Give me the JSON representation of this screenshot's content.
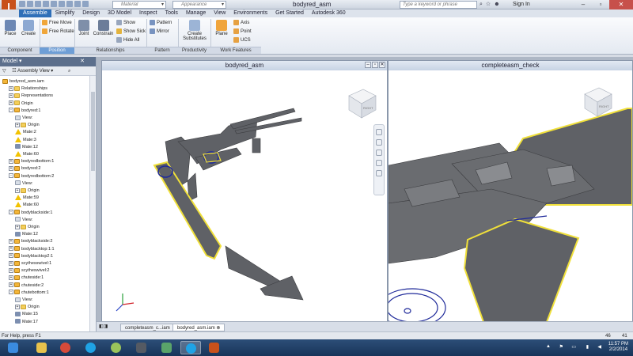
{
  "app": {
    "logo_letter": "I",
    "logo_sub": "PRO",
    "title": "bodyred_asm",
    "material": "Material",
    "appearance": "Appearance",
    "search_placeholder": "Type a keyword or phrase",
    "sign_in": "Sign In"
  },
  "ribbon_tabs": [
    "Assemble",
    "Simplify",
    "Design",
    "3D Model",
    "Inspect",
    "Tools",
    "Manage",
    "View",
    "Environments",
    "Get Started",
    "Autodesk 360"
  ],
  "ribbon": {
    "place": "Place",
    "create": "Create",
    "free_move": "Free Move",
    "free_rotate": "Free Rotate",
    "joint": "Joint",
    "constrain": "Constrain",
    "show": "Show",
    "show_sick": "Show Sick",
    "hide_all": "Hide All",
    "pattern": "Pattern",
    "mirror": "Mirror",
    "create_substitutes_1": "Create",
    "create_substitutes_2": "Substitutes",
    "plane": "Plane",
    "axis": "Axis",
    "point": "Point",
    "ucs": "UCS",
    "panels": {
      "component": "Component",
      "position": "Position",
      "relationships": "Relationships",
      "pattern": "Pattern",
      "productivity": "Productivity",
      "work_features": "Work Features"
    }
  },
  "browser": {
    "title": "Model",
    "view": "Assembly View",
    "nodes": [
      {
        "label": "bodyred_asm.iam",
        "indent": 0,
        "icon": "part",
        "exp": ""
      },
      {
        "label": "Relationships",
        "indent": 1,
        "icon": "folder",
        "exp": "+"
      },
      {
        "label": "Representations",
        "indent": 1,
        "icon": "folder",
        "exp": "+"
      },
      {
        "label": "Origin",
        "indent": 1,
        "icon": "folder",
        "exp": "+"
      },
      {
        "label": "bodyred:1",
        "indent": 1,
        "icon": "part",
        "exp": "-"
      },
      {
        "label": "View:",
        "indent": 2,
        "icon": "view",
        "exp": ""
      },
      {
        "label": "Origin",
        "indent": 2,
        "icon": "folder",
        "exp": "+"
      },
      {
        "label": "Mate:2",
        "indent": 2,
        "icon": "warn",
        "exp": ""
      },
      {
        "label": "Mate:3",
        "indent": 2,
        "icon": "warn",
        "exp": ""
      },
      {
        "label": "Mate:12",
        "indent": 2,
        "icon": "constraint",
        "exp": ""
      },
      {
        "label": "Mate:60",
        "indent": 2,
        "icon": "warn",
        "exp": ""
      },
      {
        "label": "bodyredbottom:1",
        "indent": 1,
        "icon": "part",
        "exp": "+"
      },
      {
        "label": "bodyred:2",
        "indent": 1,
        "icon": "part",
        "exp": "+"
      },
      {
        "label": "bodyredbottom:2",
        "indent": 1,
        "icon": "part",
        "exp": "-"
      },
      {
        "label": "View:",
        "indent": 2,
        "icon": "view",
        "exp": ""
      },
      {
        "label": "Origin",
        "indent": 2,
        "icon": "folder",
        "exp": "+"
      },
      {
        "label": "Mate:59",
        "indent": 2,
        "icon": "warn",
        "exp": ""
      },
      {
        "label": "Mate:60",
        "indent": 2,
        "icon": "warn",
        "exp": ""
      },
      {
        "label": "bodyblackside:1",
        "indent": 1,
        "icon": "part",
        "exp": "-"
      },
      {
        "label": "View:",
        "indent": 2,
        "icon": "view",
        "exp": ""
      },
      {
        "label": "Origin",
        "indent": 2,
        "icon": "folder",
        "exp": "+"
      },
      {
        "label": "Mate:12",
        "indent": 2,
        "icon": "constraint",
        "exp": ""
      },
      {
        "label": "bodyblackside:2",
        "indent": 1,
        "icon": "part",
        "exp": "+"
      },
      {
        "label": "bodyblacktop:1:1",
        "indent": 1,
        "icon": "part",
        "exp": "+"
      },
      {
        "label": "bodyblacktop2:1",
        "indent": 1,
        "icon": "part",
        "exp": "+"
      },
      {
        "label": "scythesswivel:1",
        "indent": 1,
        "icon": "part",
        "exp": "+"
      },
      {
        "label": "scytheswivel:2",
        "indent": 1,
        "icon": "part",
        "exp": "+"
      },
      {
        "label": "chuteside:1",
        "indent": 1,
        "icon": "part",
        "exp": "+"
      },
      {
        "label": "chuteside:2",
        "indent": 1,
        "icon": "part",
        "exp": "+"
      },
      {
        "label": "chutebottom:1",
        "indent": 1,
        "icon": "part",
        "exp": "-"
      },
      {
        "label": "View:",
        "indent": 2,
        "icon": "view",
        "exp": ""
      },
      {
        "label": "Origin",
        "indent": 2,
        "icon": "folder",
        "exp": "+"
      },
      {
        "label": "Mate:15",
        "indent": 2,
        "icon": "constraint",
        "exp": ""
      },
      {
        "label": "Mate:17",
        "indent": 2,
        "icon": "constraint",
        "exp": ""
      }
    ]
  },
  "viewports": {
    "left_title": "bodyred_asm",
    "right_title": "completeasm_check",
    "cube_face": "RIGHT"
  },
  "doc_tabs": [
    "completeasm_c...iam",
    "bodyred_asm.iam"
  ],
  "status": {
    "help": "For Help, press F1",
    "num1": "46",
    "num2": "41"
  },
  "clock": {
    "time": "11:57 PM",
    "date": "2/2/2014"
  },
  "colors": {
    "accent": "#2f6fb8",
    "part_fill": "#5f6166",
    "highlight": "#f0e03a",
    "close": "#c7504b"
  }
}
